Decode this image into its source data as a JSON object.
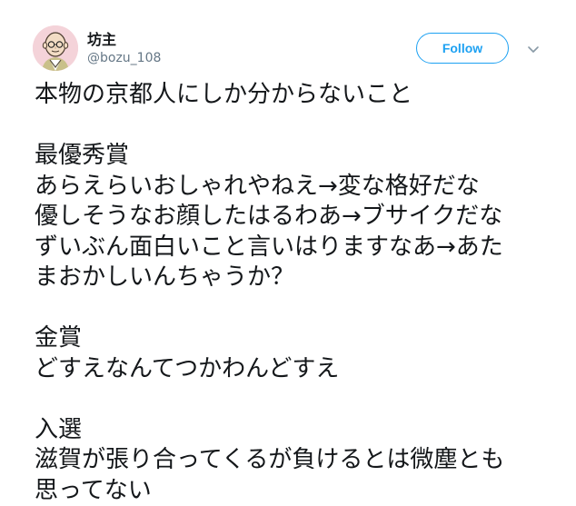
{
  "user": {
    "display_name": "坊主",
    "screen_name": "@bozu_108",
    "avatar_icon": "monk-avatar-icon"
  },
  "follow_button": {
    "label": "Follow"
  },
  "menu_caret": {
    "icon": "chevron-down-icon"
  },
  "tweet": {
    "lines": [
      "本物の京都人にしか分からないこと",
      "",
      "最優秀賞",
      "あらえらいおしゃれやねえ→変な格好だな",
      "優しそうなお顔したはるわあ→ブサイクだな",
      "ずいぶん面白いこと言いはりますなあ→あた",
      "まおかしいんちゃうか？",
      "",
      "金賞",
      "どすえなんてつかわんどすえ",
      "",
      "入選",
      "滋賀が張り合ってくるが負けるとは微塵とも",
      "思ってない"
    ]
  },
  "colors": {
    "accent": "#1da1f2",
    "text": "#14171a",
    "secondary_text": "#657786"
  }
}
